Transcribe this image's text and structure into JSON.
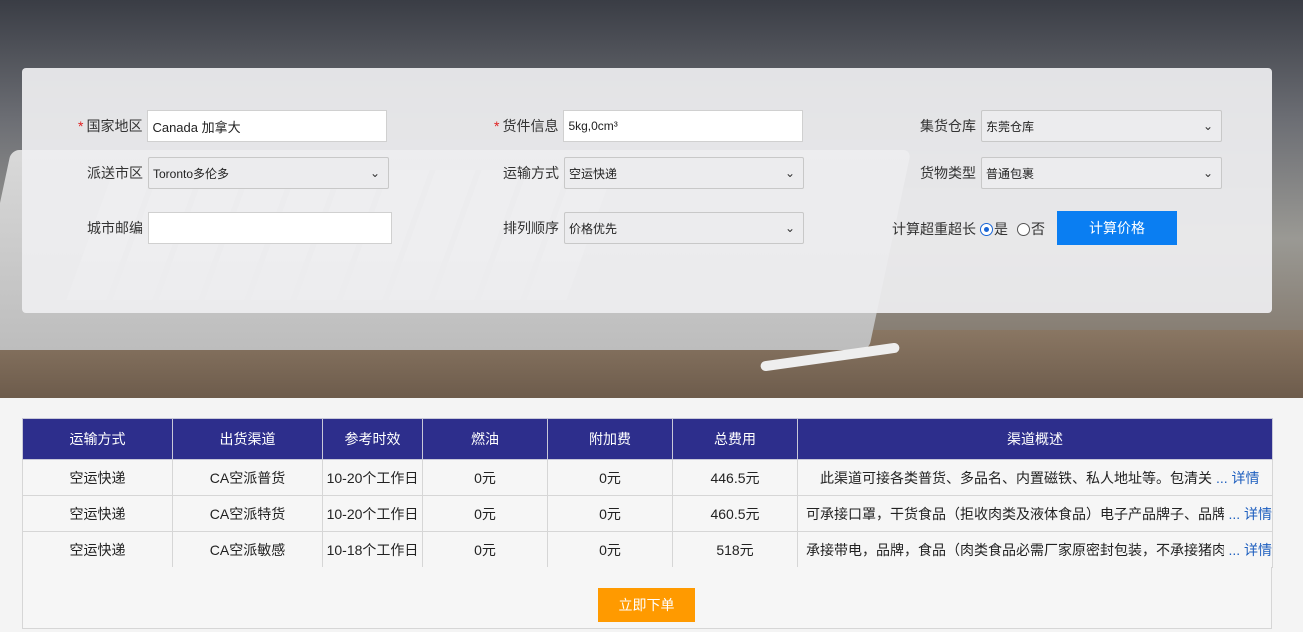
{
  "form": {
    "country": {
      "label": "国家地区",
      "value": "Canada 加拿大"
    },
    "cargo_info": {
      "label": "货件信息",
      "value": "5kg,0cm³"
    },
    "warehouse": {
      "label": "集货仓库",
      "value": "东莞仓库"
    },
    "city": {
      "label": "派送市区",
      "value": "Toronto多伦多"
    },
    "transport": {
      "label": "运输方式",
      "value": "空运快递"
    },
    "goods_type": {
      "label": "货物类型",
      "value": "普通包裹"
    },
    "postcode": {
      "label": "城市邮编",
      "value": ""
    },
    "sort": {
      "label": "排列顺序",
      "value": "价格优先"
    },
    "oversize": {
      "label": "计算超重超长",
      "yes": "是",
      "no": "否",
      "selected": "yes"
    },
    "calc_button": "计算价格"
  },
  "table": {
    "headers": [
      "运输方式",
      "出货渠道",
      "参考时效",
      "燃油",
      "附加费",
      "总费用",
      "渠道概述"
    ],
    "rows": [
      {
        "mode": "空运快递",
        "channel": "CA空派普货",
        "time": "10-20个工作日",
        "fuel": "0元",
        "surcharge": "0元",
        "total": "446.5元",
        "desc": "此渠道可接各类普货、多品名、内置磁铁、私人地址等。包清关",
        "more": "... 详情"
      },
      {
        "mode": "空运快递",
        "channel": "CA空派特货",
        "time": "10-20个工作日",
        "fuel": "0元",
        "surcharge": "0元",
        "total": "460.5元",
        "desc": "可承接口罩，干货食品（拒收肉类及液体食品）电子产品牌子、品牌",
        "more": "... 详情"
      },
      {
        "mode": "空运快递",
        "channel": "CA空派敏感",
        "time": "10-18个工作日",
        "fuel": "0元",
        "surcharge": "0元",
        "total": "518元",
        "desc": "承接带电，品牌，食品（肉类食品必需厂家原密封包装，不承接猪肉",
        "more": "... 详情"
      }
    ]
  },
  "order_button": "立即下单"
}
